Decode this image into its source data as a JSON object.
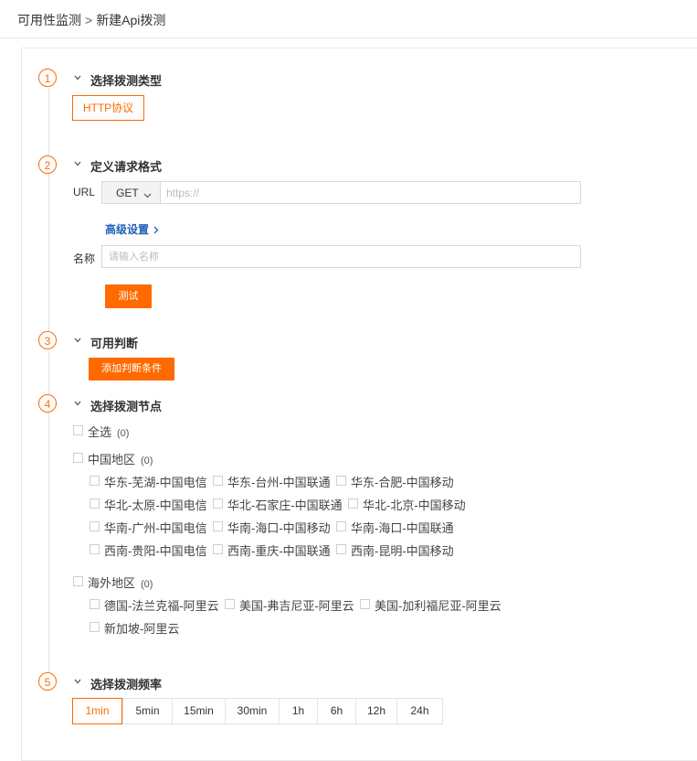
{
  "breadcrumb": {
    "parent": "可用性监测",
    "separator": ">",
    "current": "新建Api拨测"
  },
  "steps": [
    {
      "num": "1",
      "title": "选择拨测类型"
    },
    {
      "num": "2",
      "title": "定义请求格式"
    },
    {
      "num": "3",
      "title": "可用判断"
    },
    {
      "num": "4",
      "title": "选择拨测节点"
    },
    {
      "num": "5",
      "title": "选择拨测频率"
    }
  ],
  "type_button": "HTTP协议",
  "request": {
    "url_label": "URL",
    "method": "GET",
    "url_placeholder": "https://",
    "advanced_label": "高级设置",
    "name_label": "名称",
    "name_placeholder": "请输入名称",
    "test_button": "测试"
  },
  "judge": {
    "add_button": "添加判断条件"
  },
  "nodes": {
    "select_all": {
      "label": "全选",
      "count": "(0)"
    },
    "china": {
      "label": "中国地区",
      "count": "(0)",
      "items": [
        "华东-芜湖-中国电信",
        "华东-台州-中国联通",
        "华东-合肥-中国移动",
        "华北-太原-中国电信",
        "华北-石家庄-中国联通",
        "华北-北京-中国移动",
        "华南-广州-中国电信",
        "华南-海口-中国移动",
        "华南-海口-中国联通",
        "西南-贵阳-中国电信",
        "西南-重庆-中国联通",
        "西南-昆明-中国移动"
      ]
    },
    "overseas": {
      "label": "海外地区",
      "count": "(0)",
      "items": [
        "德国-法兰克福-阿里云",
        "美国-弗吉尼亚-阿里云",
        "美国-加利福尼亚-阿里云",
        "新加坡-阿里云"
      ]
    }
  },
  "frequency": {
    "options": [
      "1min",
      "5min",
      "15min",
      "30min",
      "1h",
      "6h",
      "12h",
      "24h"
    ],
    "selected": "1min"
  },
  "colors": {
    "accent": "#ff6a00",
    "link": "#1f5fb8"
  }
}
